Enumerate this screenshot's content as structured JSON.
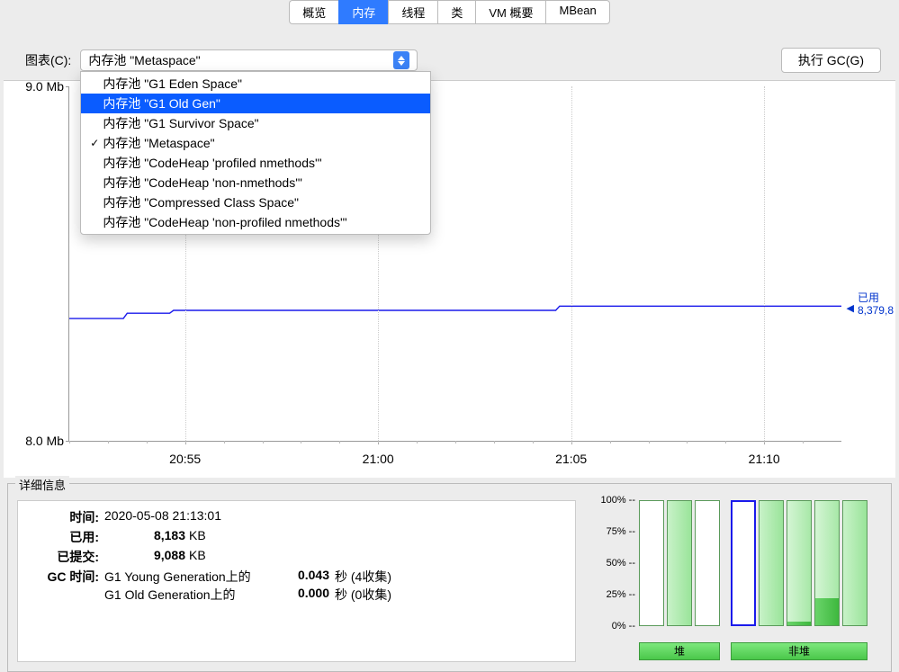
{
  "tabs": {
    "items": [
      "概览",
      "内存",
      "线程",
      "类",
      "VM 概要",
      "MBean"
    ],
    "active_index": 1
  },
  "controls": {
    "chart_label": "图表(C):",
    "combo_selected": "内存池 \"Metaspace\"",
    "gc_button": "执行 GC(G)"
  },
  "dropdown": {
    "items": [
      {
        "label": "内存池 \"G1 Eden Space\"",
        "checked": false,
        "highlight": false
      },
      {
        "label": "内存池 \"G1 Old Gen\"",
        "checked": false,
        "highlight": true
      },
      {
        "label": "内存池 \"G1 Survivor Space\"",
        "checked": false,
        "highlight": false
      },
      {
        "label": "内存池 \"Metaspace\"",
        "checked": true,
        "highlight": false
      },
      {
        "label": "内存池 \"CodeHeap 'profiled nmethods'\"",
        "checked": false,
        "highlight": false
      },
      {
        "label": "内存池 \"CodeHeap 'non-nmethods'\"",
        "checked": false,
        "highlight": false
      },
      {
        "label": "内存池 \"Compressed Class Space\"",
        "checked": false,
        "highlight": false
      },
      {
        "label": "内存池 \"CodeHeap 'non-profiled nmethods'\"",
        "checked": false,
        "highlight": false
      }
    ]
  },
  "chart_data": {
    "type": "line",
    "title": "",
    "xlabel": "",
    "ylabel": "",
    "y_ticks": [
      {
        "label": "9.0 Mb",
        "frac": 0.0
      },
      {
        "label": "8.0 Mb",
        "frac": 1.0
      }
    ],
    "x_ticks": [
      {
        "label": "20:55",
        "frac": 0.15
      },
      {
        "label": "21:00",
        "frac": 0.4
      },
      {
        "label": "21:05",
        "frac": 0.65
      },
      {
        "label": "21:10",
        "frac": 0.9
      }
    ],
    "series": [
      {
        "name": "已用",
        "points": [
          {
            "x": 0.0,
            "y": 0.655
          },
          {
            "x": 0.07,
            "y": 0.655
          },
          {
            "x": 0.075,
            "y": 0.64
          },
          {
            "x": 0.13,
            "y": 0.64
          },
          {
            "x": 0.135,
            "y": 0.632
          },
          {
            "x": 0.63,
            "y": 0.632
          },
          {
            "x": 0.635,
            "y": 0.62
          },
          {
            "x": 1.0,
            "y": 0.62
          }
        ]
      }
    ],
    "used_marker": {
      "label_top": "已用",
      "label_bottom": "8,379,8",
      "y": 0.62
    }
  },
  "details": {
    "title": "详细信息",
    "rows": {
      "time_label": "时间:",
      "time_value": "2020-05-08 21:13:01",
      "used_label": "已用:",
      "used_num": "8,183",
      "used_unit": "KB",
      "committed_label": "已提交:",
      "committed_num": "9,088",
      "committed_unit": "KB",
      "gc_label": "GC 时间:",
      "gc_lines": [
        {
          "name": "G1 Young Generation上的",
          "time": "0.043",
          "suffix": "秒 (4收集)"
        },
        {
          "name": "G1 Old Generation上的",
          "time": "0.000",
          "suffix": "秒 (0收集)"
        }
      ]
    },
    "bars": {
      "y_ticks": [
        "100%",
        "75%",
        "50%",
        "25%",
        "0%"
      ],
      "items": [
        {
          "pct": 0,
          "selected": false,
          "group": 0
        },
        {
          "pct": 100,
          "selected": false,
          "group": 0
        },
        {
          "pct": 0,
          "selected": false,
          "group": 0
        },
        {
          "pct": 0,
          "selected": true,
          "group": 1
        },
        {
          "pct": 100,
          "selected": false,
          "group": 1
        },
        {
          "pct": 3,
          "selected": false,
          "group": 1
        },
        {
          "pct": 22,
          "selected": false,
          "group": 1
        },
        {
          "pct": 100,
          "selected": false,
          "group": 1
        }
      ],
      "groups": [
        {
          "label": "堆",
          "start": 0,
          "end": 3
        },
        {
          "label": "非堆",
          "start": 3,
          "end": 8
        }
      ]
    }
  }
}
